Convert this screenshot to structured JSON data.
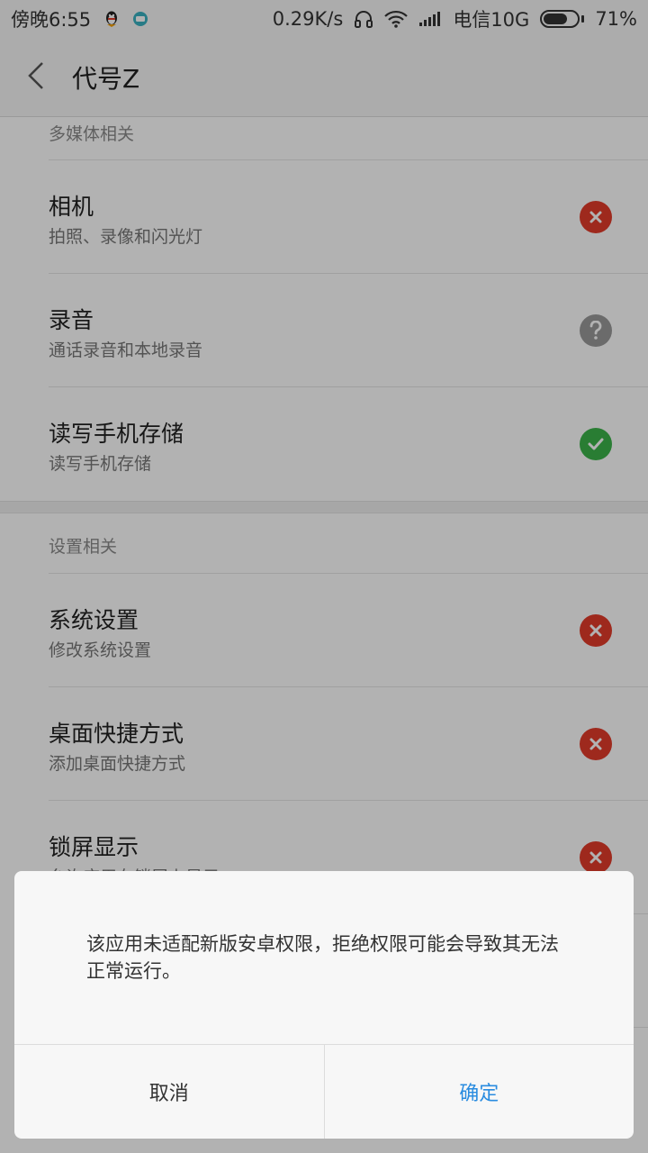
{
  "status_bar": {
    "time": "傍晚6:55",
    "net_speed": "0.29K/s",
    "carrier": "电信10G",
    "battery": "71%",
    "battery_level": 0.71,
    "icons": [
      "qq-icon",
      "app-notification-icon",
      "headphones-icon",
      "wifi-icon",
      "signal-icon",
      "battery-icon"
    ]
  },
  "appbar": {
    "title": "代号Z",
    "back_icon": "chevron-left-icon"
  },
  "sections": [
    {
      "header": "多媒体相关",
      "items": [
        {
          "title": "相机",
          "subtitle": "拍照、录像和闪光灯",
          "status": "deny"
        },
        {
          "title": "录音",
          "subtitle": "通话录音和本地录音",
          "status": "ask"
        },
        {
          "title": "读写手机存储",
          "subtitle": "读写手机存储",
          "status": "allow"
        }
      ]
    },
    {
      "header": "设置相关",
      "items": [
        {
          "title": "系统设置",
          "subtitle": "修改系统设置",
          "status": "deny"
        },
        {
          "title": "桌面快捷方式",
          "subtitle": "添加桌面快捷方式",
          "status": "deny"
        },
        {
          "title": "锁屏显示",
          "subtitle": "允许应用在锁屏上显示",
          "status": "deny"
        }
      ]
    }
  ],
  "dialog": {
    "message": "该应用未适配新版安卓权限，拒绝权限可能会导致其无法正常运行。",
    "cancel": "取消",
    "confirm": "确定"
  },
  "colors": {
    "deny": "#e23b2a",
    "ask": "#9a9a9a",
    "allow": "#3cb34a",
    "accent": "#2a8ce0"
  }
}
